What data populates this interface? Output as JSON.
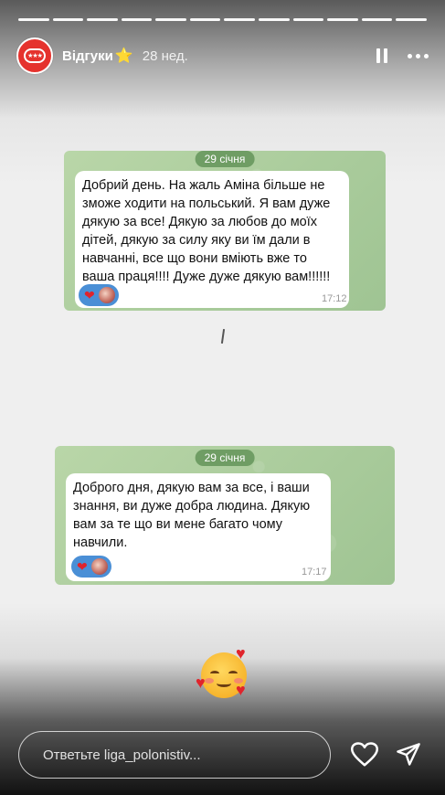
{
  "story": {
    "segments": 12,
    "username": "Відгуки",
    "username_badge": "⭐",
    "time_ago": "28 нед."
  },
  "messages": [
    {
      "date": "29 січня",
      "text": "Добрий день. На жаль Аміна більше не зможе ходити на польський. Я вам дуже дякую за все! Дякую за любов до моїх дітей, дякую за силу яку ви їм дали в навчанні, все що вони вміють вже то ваша праця!!!! Дуже дуже дякую вам!!!!!!",
      "time": "17:12",
      "reaction": "❤"
    },
    {
      "date": "29 січня",
      "text": "Доброго дня, дякую вам за все, і ваши знання, ви дуже добра людина. Дякую вам за те що ви мене багато чому навчили.",
      "time": "17:17",
      "reaction": "❤"
    }
  ],
  "sticker": {
    "icon": "smiling-face-with-hearts-icon"
  },
  "reply": {
    "placeholder": "Ответьте liga_polonistiv..."
  },
  "colors": {
    "avatar": "#e5322d",
    "card_green": "#a8c99b",
    "reaction_blue": "#4a8fd6",
    "heart_red": "#e0242c"
  }
}
